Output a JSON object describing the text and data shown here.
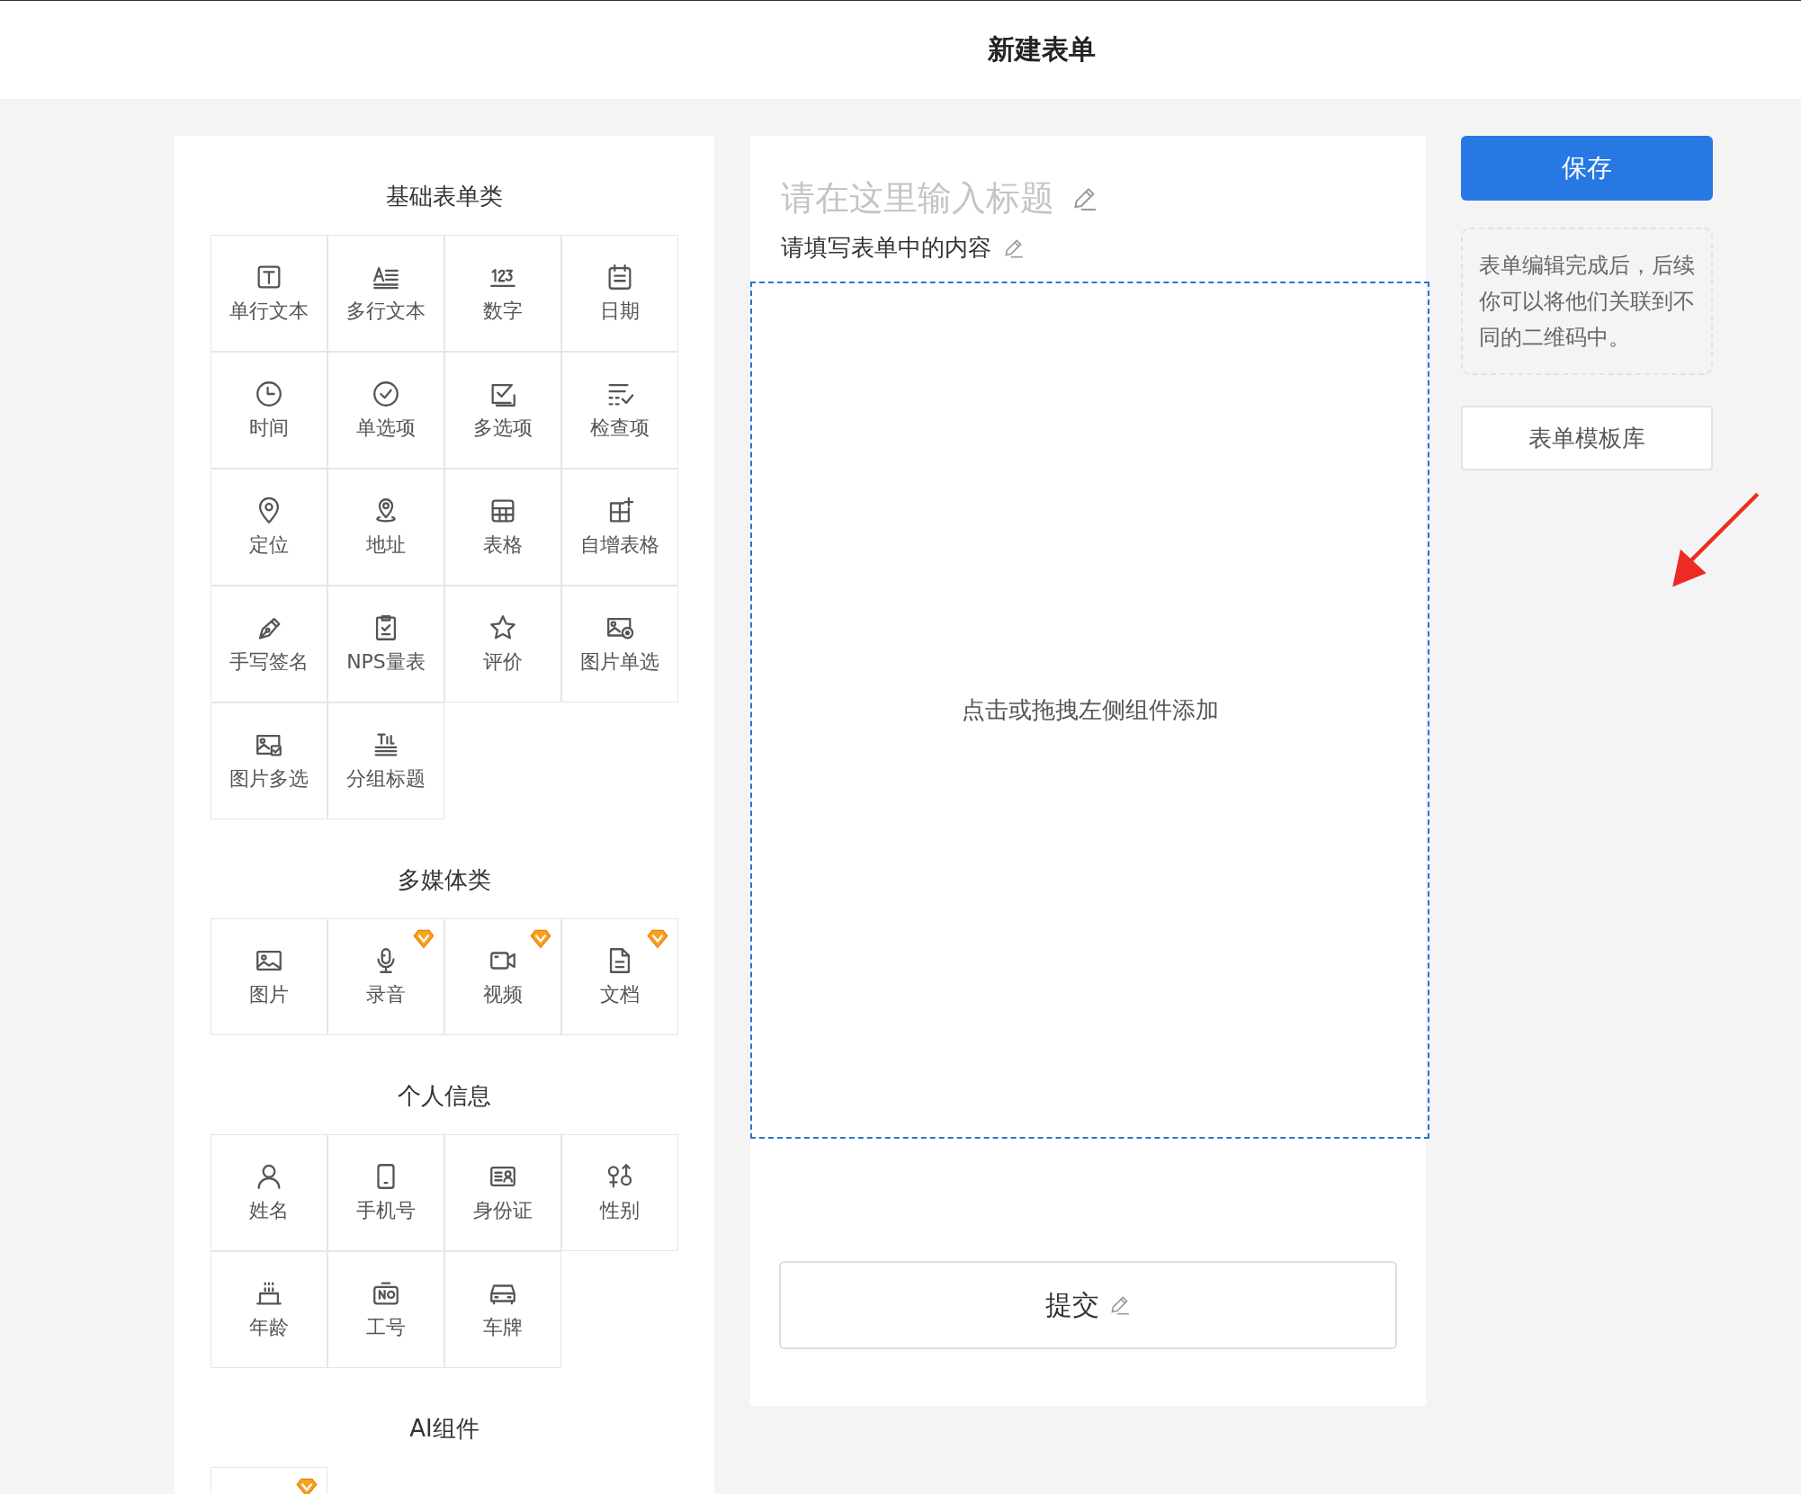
{
  "header": {
    "title": "新建表单"
  },
  "sections": [
    {
      "title": "基础表单类",
      "items": [
        {
          "label": "单行文本",
          "premium": false
        },
        {
          "label": "多行文本",
          "premium": false
        },
        {
          "label": "数字",
          "premium": false
        },
        {
          "label": "日期",
          "premium": false
        },
        {
          "label": "时间",
          "premium": false
        },
        {
          "label": "单选项",
          "premium": false
        },
        {
          "label": "多选项",
          "premium": false
        },
        {
          "label": "检查项",
          "premium": false
        },
        {
          "label": "定位",
          "premium": false
        },
        {
          "label": "地址",
          "premium": false
        },
        {
          "label": "表格",
          "premium": false
        },
        {
          "label": "自增表格",
          "premium": false
        },
        {
          "label": "手写签名",
          "premium": false
        },
        {
          "label": "NPS量表",
          "premium": false
        },
        {
          "label": "评价",
          "premium": false
        },
        {
          "label": "图片单选",
          "premium": false
        },
        {
          "label": "图片多选",
          "premium": false
        },
        {
          "label": "分组标题",
          "premium": false
        }
      ]
    },
    {
      "title": "多媒体类",
      "items": [
        {
          "label": "图片",
          "premium": false
        },
        {
          "label": "录音",
          "premium": true
        },
        {
          "label": "视频",
          "premium": true
        },
        {
          "label": "文档",
          "premium": true
        }
      ]
    },
    {
      "title": "个人信息",
      "items": [
        {
          "label": "姓名",
          "premium": false
        },
        {
          "label": "手机号",
          "premium": false
        },
        {
          "label": "身份证",
          "premium": false
        },
        {
          "label": "性别",
          "premium": false
        },
        {
          "label": "年龄",
          "premium": false
        },
        {
          "label": "工号",
          "premium": false
        },
        {
          "label": "车牌",
          "premium": false
        }
      ]
    },
    {
      "title": "AI组件",
      "items": [
        {
          "premium": true
        }
      ]
    }
  ],
  "form": {
    "title_placeholder": "请在这里输入标题",
    "description": "请填写表单中的内容",
    "drop_hint": "点击或拖拽左侧组件添加",
    "submit": "提交"
  },
  "sidebar": {
    "save": "保存",
    "note": "表单编辑完成后，后续你可以将他们关联到不同的二维码中。",
    "template_library": "表单模板库"
  }
}
